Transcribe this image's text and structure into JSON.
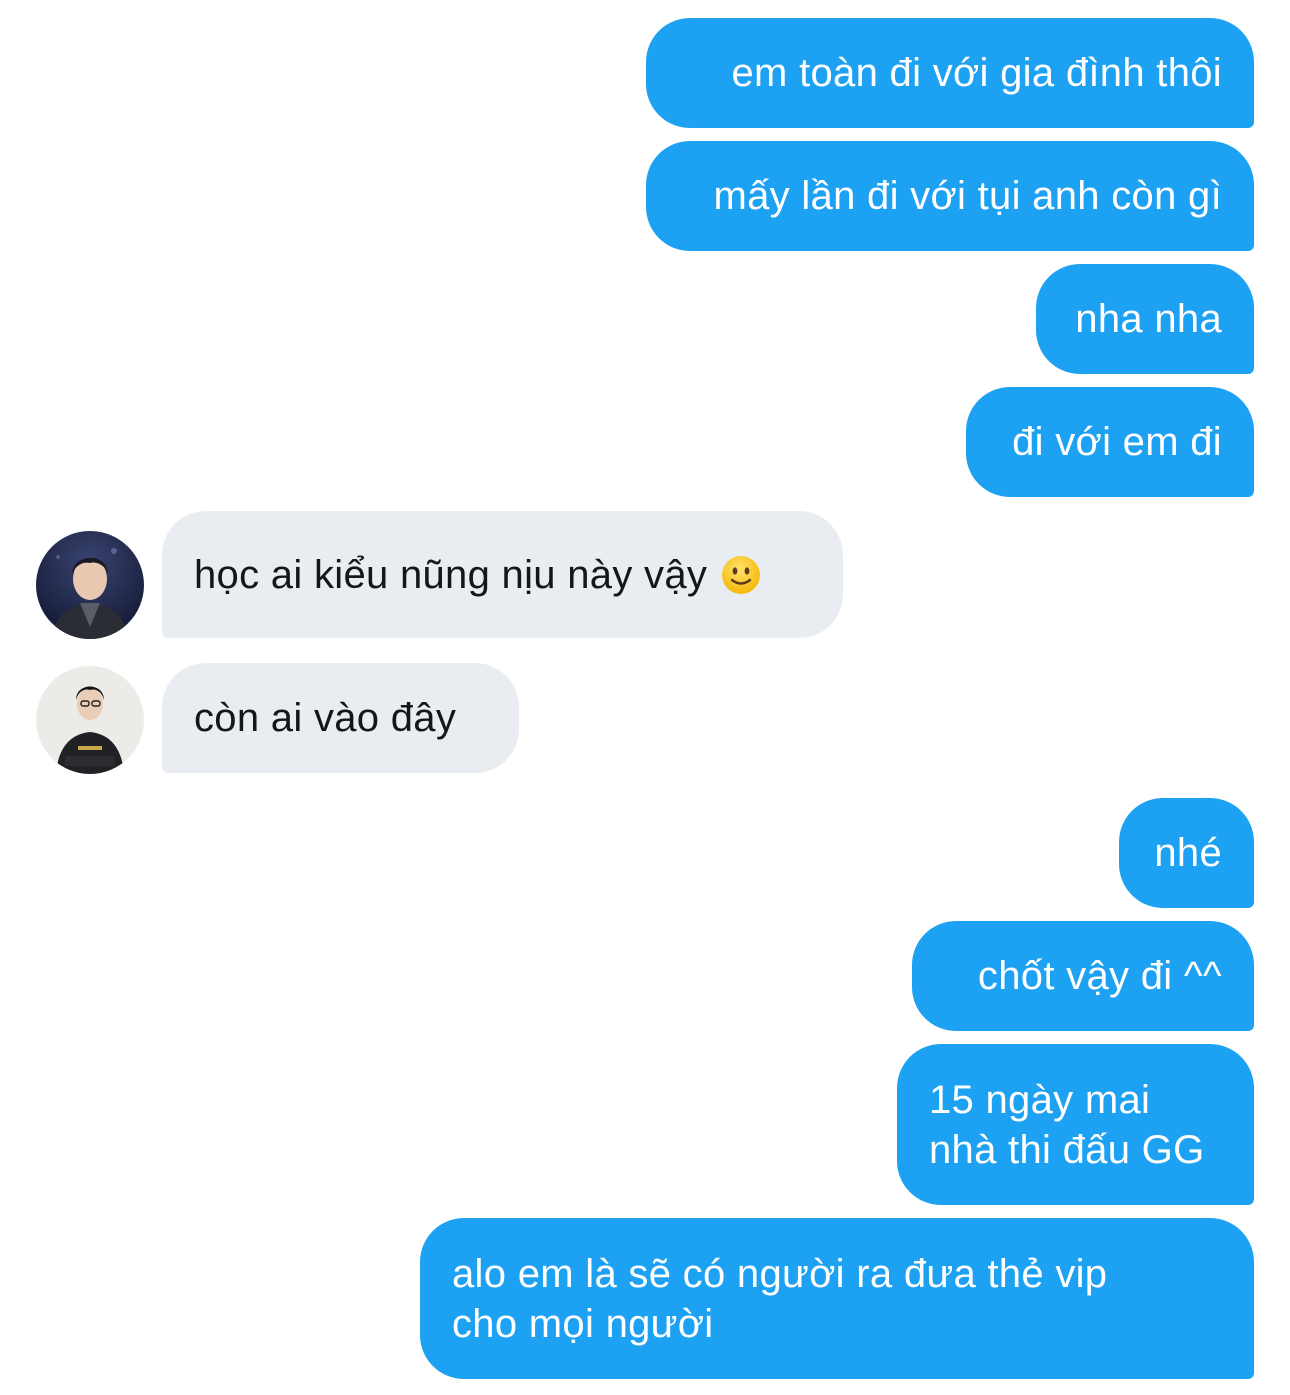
{
  "messages": [
    {
      "from": "me",
      "text": "em toàn đi với gia đình thôi"
    },
    {
      "from": "me",
      "text": "mấy lần đi với tụi anh còn gì"
    },
    {
      "from": "me",
      "text": "nha nha"
    },
    {
      "from": "me",
      "text": "đi với em đi"
    },
    {
      "from": "other",
      "avatar": "avatar-user-1",
      "text": "học ai kiểu nũng nịu này vậy",
      "emoji": "slightly-smiling-face-icon"
    },
    {
      "from": "other",
      "avatar": "avatar-user-2",
      "text": "còn ai vào đây"
    },
    {
      "from": "me",
      "text": "nhé"
    },
    {
      "from": "me",
      "text": "chốt vậy đi ^^"
    },
    {
      "from": "me",
      "lines": [
        "15 ngày mai",
        "nhà thi đấu GG"
      ]
    },
    {
      "from": "me",
      "lines": [
        "alo em là sẽ có người ra đưa thẻ vip",
        "cho mọi người"
      ]
    }
  ],
  "colors": {
    "sent_bubble": "#1da1f2",
    "received_bubble": "#e9edf1",
    "sent_text": "#ffffff",
    "received_text": "#14171a"
  }
}
